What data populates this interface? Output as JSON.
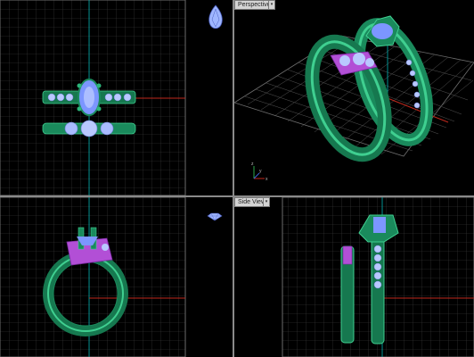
{
  "viewports": {
    "top_right": {
      "label": "Perspective",
      "menu_glyph": "▾"
    },
    "bottom_right": {
      "label": "Side View",
      "menu_glyph": "▾"
    }
  },
  "axis_triad": {
    "x": "x",
    "y": "y",
    "z": "z"
  },
  "colors": {
    "grid": "#4a4a4a",
    "grid_major": "#6e6e6e",
    "metal": "#1a8a5c",
    "metal_light": "#3fcf90",
    "stone_blue": "#9fb6ff",
    "stone_purple": "#b24fd6",
    "axis_red": "#c0281c",
    "axis_cyan": "#00b4b4"
  },
  "icons": {
    "pear_stone": "pear-gem-icon",
    "round_stone": "round-gem-icon"
  }
}
